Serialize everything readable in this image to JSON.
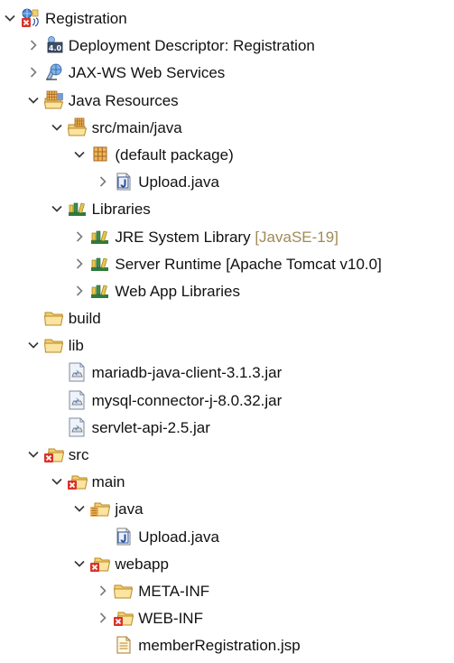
{
  "tree": [
    {
      "label": "Registration",
      "decoration": "",
      "icon": "web-project-error-icon",
      "expander": "expanded",
      "level": 0
    },
    {
      "label": "Deployment Descriptor: Registration",
      "decoration": "",
      "icon": "deployment-descriptor-icon",
      "expander": "collapsed",
      "level": 1
    },
    {
      "label": "JAX-WS Web Services",
      "decoration": "",
      "icon": "web-services-icon",
      "expander": "collapsed",
      "level": 1
    },
    {
      "label": "Java Resources",
      "decoration": "",
      "icon": "java-resources-icon",
      "expander": "expanded",
      "level": 1
    },
    {
      "label": "src/main/java",
      "decoration": "",
      "icon": "source-folder-icon",
      "expander": "expanded",
      "level": 2
    },
    {
      "label": "(default package)",
      "decoration": "",
      "icon": "package-icon",
      "expander": "expanded",
      "level": 3
    },
    {
      "label": "Upload.java",
      "decoration": "",
      "icon": "java-file-icon",
      "expander": "collapsed",
      "level": 4
    },
    {
      "label": "Libraries",
      "decoration": "",
      "icon": "libraries-icon",
      "expander": "expanded",
      "level": 2
    },
    {
      "label": "JRE System Library",
      "decoration": "[JavaSE-19]",
      "icon": "library-icon",
      "expander": "collapsed",
      "level": 3
    },
    {
      "label": "Server Runtime [Apache Tomcat v10.0]",
      "decoration": "",
      "icon": "library-icon",
      "expander": "collapsed",
      "level": 3
    },
    {
      "label": "Web App Libraries",
      "decoration": "",
      "icon": "library-icon",
      "expander": "collapsed",
      "level": 3
    },
    {
      "label": "build",
      "decoration": "",
      "icon": "folder-icon",
      "expander": "none",
      "level": 1
    },
    {
      "label": "lib",
      "decoration": "",
      "icon": "folder-icon",
      "expander": "expanded",
      "level": 1
    },
    {
      "label": "mariadb-java-client-3.1.3.jar",
      "decoration": "",
      "icon": "jar-icon",
      "expander": "none",
      "level": 2
    },
    {
      "label": "mysql-connector-j-8.0.32.jar",
      "decoration": "",
      "icon": "jar-icon",
      "expander": "none",
      "level": 2
    },
    {
      "label": "servlet-api-2.5.jar",
      "decoration": "",
      "icon": "jar-icon",
      "expander": "none",
      "level": 2
    },
    {
      "label": "src",
      "decoration": "",
      "icon": "folder-error-icon",
      "expander": "expanded",
      "level": 1
    },
    {
      "label": "main",
      "decoration": "",
      "icon": "folder-error-icon",
      "expander": "expanded",
      "level": 2
    },
    {
      "label": "java",
      "decoration": "",
      "icon": "folder-java-icon",
      "expander": "expanded",
      "level": 3
    },
    {
      "label": "Upload.java",
      "decoration": "",
      "icon": "java-file-icon",
      "expander": "none",
      "level": 4
    },
    {
      "label": "webapp",
      "decoration": "",
      "icon": "folder-error-icon",
      "expander": "expanded",
      "level": 3
    },
    {
      "label": "META-INF",
      "decoration": "",
      "icon": "folder-icon",
      "expander": "collapsed",
      "level": 4
    },
    {
      "label": "WEB-INF",
      "decoration": "",
      "icon": "folder-error-icon",
      "expander": "collapsed",
      "level": 4
    },
    {
      "label": "memberRegistration.jsp",
      "decoration": "",
      "icon": "jsp-file-icon",
      "expander": "none",
      "level": 4
    }
  ],
  "colors": {
    "folder": "#e8b84a",
    "error": "#d9332a",
    "library": "#2c7b3e",
    "java_j": "#2a4f9a",
    "decoration": "#a08a57"
  }
}
